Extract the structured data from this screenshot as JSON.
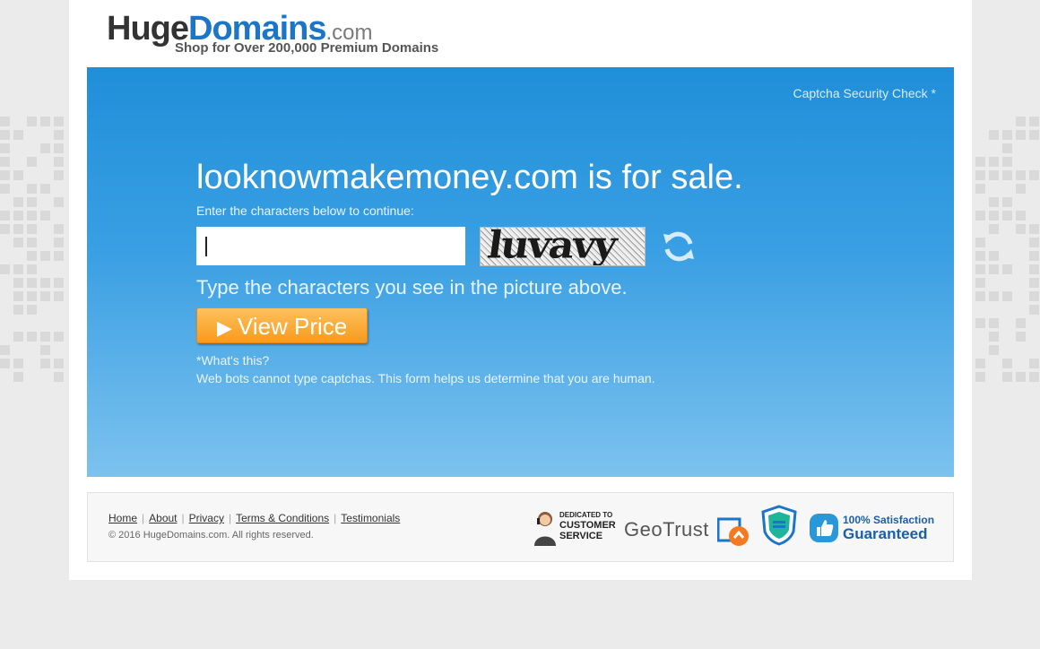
{
  "site": {
    "logo_huge": "Huge",
    "logo_domains": "Domains",
    "logo_com": ".com",
    "logo_tagline": "Shop for Over 200,000 Premium Domains"
  },
  "hero": {
    "captcha_check": "Captcha Security Check *",
    "title": "looknowmakemoney.com is for sale.",
    "instruction": "Enter the characters below to continue:",
    "captcha_input_value": "",
    "captcha_text": "luvavy",
    "type_prompt": "Type the characters you see in the picture above.",
    "view_price_label": "View Price",
    "whats_this": "*What's this?",
    "explanation": "Web bots cannot type captchas. This form helps us determine that you are human."
  },
  "footer": {
    "links": [
      "Home",
      "About",
      "Privacy",
      "Terms & Conditions",
      "Testimonials"
    ],
    "copyright": "© 2016 HugeDomains.com. All rights reserved.",
    "badge_customer_service_top": "DEDICATED TO",
    "badge_customer_service_main": "CUSTOMER SERVICE",
    "badge_geotrust": "GeoTrust",
    "badge_satisfaction_top": "100% Satisfaction",
    "badge_satisfaction_main": "Guaranteed"
  },
  "colors": {
    "brand_blue": "#1c75c6",
    "hero_top": "#1f8fd9",
    "hero_bottom": "#7cc2ee",
    "button_orange": "#f89b1c"
  },
  "icons": [
    "refresh-icon",
    "play-arrow-icon",
    "customer-service-icon",
    "geotrust-icon",
    "shield-icon",
    "thumbs-up-icon"
  ]
}
